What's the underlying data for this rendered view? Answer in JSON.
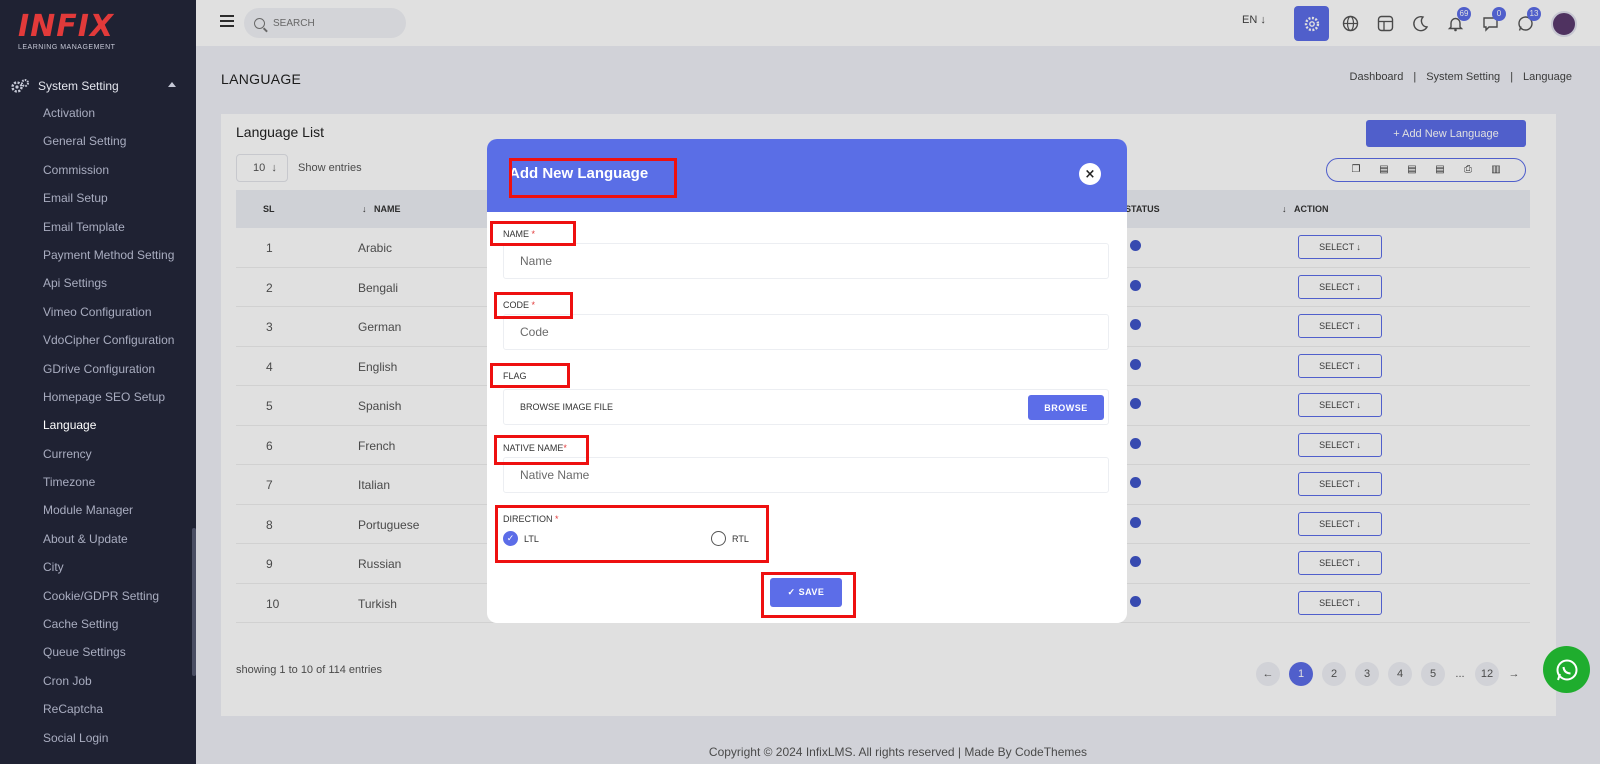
{
  "brand": {
    "logo": "INFIX",
    "tagline": "LEARNING MANAGEMENT"
  },
  "sidebar": {
    "group_label": "System Setting",
    "items": [
      {
        "label": "Activation"
      },
      {
        "label": "General Setting"
      },
      {
        "label": "Commission"
      },
      {
        "label": "Email Setup"
      },
      {
        "label": "Email Template"
      },
      {
        "label": "Payment Method Setting"
      },
      {
        "label": "Api Settings"
      },
      {
        "label": "Vimeo Configuration"
      },
      {
        "label": "VdoCipher Configuration"
      },
      {
        "label": "GDrive Configuration"
      },
      {
        "label": "Homepage SEO Setup"
      },
      {
        "label": "Language"
      },
      {
        "label": "Currency"
      },
      {
        "label": "Timezone"
      },
      {
        "label": "Module Manager"
      },
      {
        "label": "About & Update"
      },
      {
        "label": "City"
      },
      {
        "label": "Cookie/GDPR Setting"
      },
      {
        "label": "Cache Setting"
      },
      {
        "label": "Queue Settings"
      },
      {
        "label": "Cron Job"
      },
      {
        "label": "ReCaptcha"
      },
      {
        "label": "Social Login"
      }
    ],
    "active_item": "Language"
  },
  "topbar": {
    "search_placeholder": "SEARCH",
    "language": "EN",
    "notifications_count": "69",
    "messages_count": "0",
    "whatsapp_count": "13"
  },
  "page": {
    "title": "LANGUAGE",
    "breadcrumb": [
      "Dashboard",
      "System Setting",
      "Language"
    ]
  },
  "list": {
    "title": "Language List",
    "add_button": "+ Add New Language",
    "entries_value": "10",
    "entries_label": "Show entries",
    "columns": {
      "sl": "SL",
      "name": "NAME",
      "status": "STATUS",
      "action": "ACTION"
    },
    "rows": [
      {
        "sl": "1",
        "name": "Arabic"
      },
      {
        "sl": "2",
        "name": "Bengali"
      },
      {
        "sl": "3",
        "name": "German"
      },
      {
        "sl": "4",
        "name": "English"
      },
      {
        "sl": "5",
        "name": "Spanish"
      },
      {
        "sl": "6",
        "name": "French"
      },
      {
        "sl": "7",
        "name": "Italian"
      },
      {
        "sl": "8",
        "name": "Portuguese"
      },
      {
        "sl": "9",
        "name": "Russian"
      },
      {
        "sl": "10",
        "name": "Turkish"
      }
    ],
    "select_label": "SELECT",
    "showing": "showing 1 to 10 of 114 entries",
    "pages": [
      "1",
      "2",
      "3",
      "4",
      "5",
      "...",
      "12"
    ]
  },
  "footer": "Copyright © 2024 InfixLMS. All rights reserved | Made By CodeThemes",
  "modal": {
    "title": "Add New Language",
    "close_icon": "×",
    "name_label": "NAME",
    "name_placeholder": "Name",
    "code_label": "CODE",
    "code_placeholder": "Code",
    "flag_label": "FLAG",
    "flag_text": "BROWSE IMAGE FILE",
    "browse_label": "BROWSE",
    "native_label": "NATIVE NAME",
    "native_placeholder": "Native Name",
    "direction_label": "DIRECTION",
    "direction_options": [
      "LTL",
      "RTL"
    ],
    "direction_selected": "LTL",
    "save_label": "✓ SAVE",
    "required_mark": "*"
  },
  "colors": {
    "primary": "#5c6de8",
    "sidebar": "#1f2233",
    "highlight": "#ee1010",
    "required": "#e23a3a"
  }
}
